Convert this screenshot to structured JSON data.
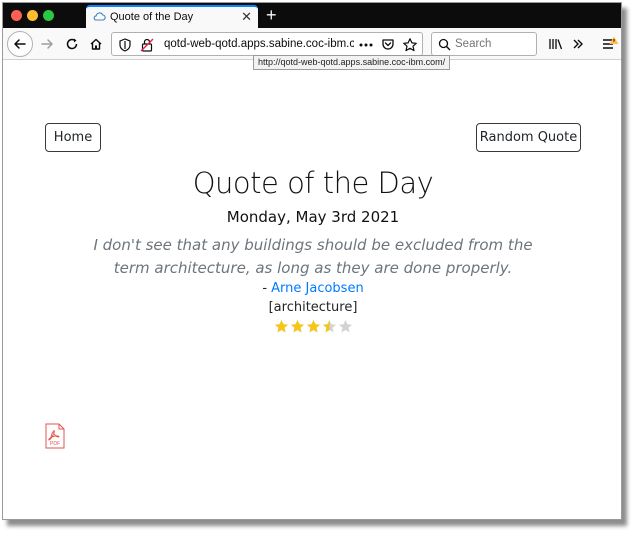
{
  "browser": {
    "tab": {
      "title": "Quote of the Day",
      "icon": "cloud-icon",
      "close_label": "✕"
    },
    "new_tab_label": "+",
    "url_display": "qotd-web-qotd.apps.sabine.coc-ibm.co",
    "url_tooltip": "http://qotd-web-qotd.apps.sabine.coc-ibm.com/",
    "search_placeholder": "Search",
    "accent_color": "#0a84ff"
  },
  "page": {
    "nav": {
      "home_label": "Home",
      "random_quote_label": "Random Quote"
    },
    "title": "Quote of the Day",
    "date": "Monday, May 3rd 2021",
    "quote_text": "I don't see that any buildings should be excluded from the term architecture, as long as they are done properly.",
    "author_prefix": "- ",
    "author": "Arne Jacobsen",
    "category": "[architecture]",
    "rating": {
      "value": 3.5,
      "max": 5
    },
    "link_color": "#007bff",
    "star_color": "#f5c518"
  }
}
